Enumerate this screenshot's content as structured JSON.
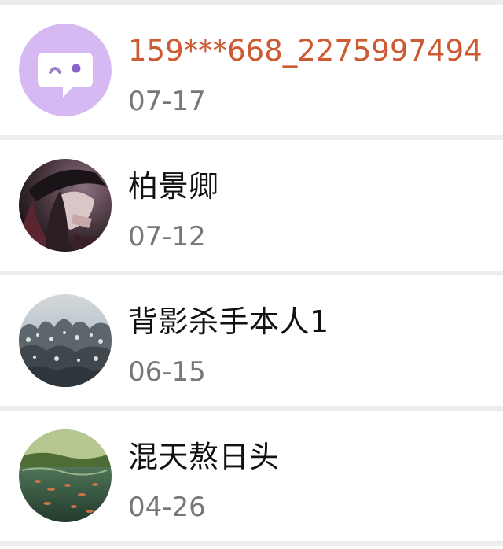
{
  "colors": {
    "divider": "#ededed",
    "name_default": "#111111",
    "name_highlight": "#cc5a33",
    "date": "#777777",
    "default_avatar_bg": "#d6b8f3"
  },
  "contacts": [
    {
      "name": "159***668_2275997494",
      "date": "07-17",
      "highlighted": true,
      "avatar": "default-chat-bubble-icon"
    },
    {
      "name": "柏景卿",
      "date": "07-12",
      "highlighted": false,
      "avatar": "photo-girl-hat"
    },
    {
      "name": "背影杀手本人1",
      "date": "06-15",
      "highlighted": false,
      "avatar": "photo-snowy-trees"
    },
    {
      "name": "混天熬日头",
      "date": "04-26",
      "highlighted": false,
      "avatar": "photo-koi-pond"
    }
  ]
}
